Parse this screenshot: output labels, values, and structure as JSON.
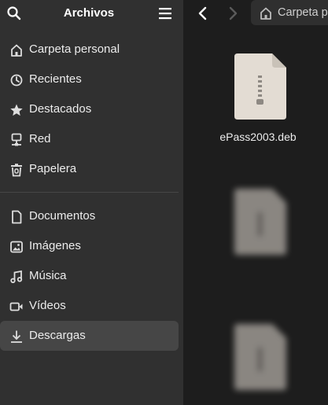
{
  "sidebar": {
    "title": "Archivos",
    "items": [
      {
        "label": "Carpeta personal",
        "icon": "home-icon"
      },
      {
        "label": "Recientes",
        "icon": "clock-icon"
      },
      {
        "label": "Destacados",
        "icon": "star-icon"
      },
      {
        "label": "Red",
        "icon": "network-icon"
      },
      {
        "label": "Papelera",
        "icon": "trash-icon"
      },
      {
        "label": "Documentos",
        "icon": "document-icon"
      },
      {
        "label": "Imágenes",
        "icon": "image-icon"
      },
      {
        "label": "Música",
        "icon": "music-icon"
      },
      {
        "label": "Vídeos",
        "icon": "video-icon"
      },
      {
        "label": "Descargas",
        "icon": "download-icon",
        "active": true
      }
    ]
  },
  "toolbar": {
    "path_label": "Carpeta personal"
  },
  "files": [
    {
      "name": "ePass2003.deb",
      "icon": "archive-file-icon"
    },
    {
      "name": "",
      "icon": "archive-file-icon",
      "blurred": true
    },
    {
      "name": "",
      "icon": "archive-file-icon",
      "blurred": true
    }
  ],
  "colors": {
    "sidebar_bg": "#303030",
    "main_bg": "#1d1d1d",
    "active_item_bg": "#464646",
    "file_icon": "#e0d9cf"
  }
}
